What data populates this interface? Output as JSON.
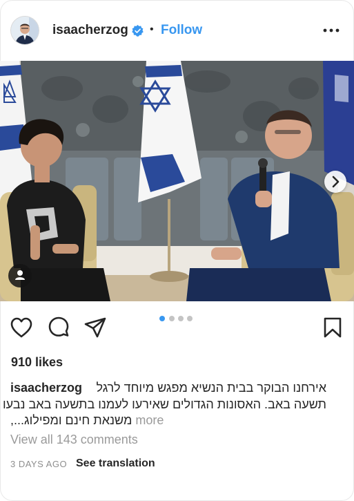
{
  "header": {
    "username": "isaacherzog",
    "separator": "•",
    "follow_label": "Follow"
  },
  "post": {
    "carousel_current_index": 1,
    "carousel_total": 4,
    "likes": "910 likes",
    "caption": {
      "username": "isaacherzog",
      "line1": "אירחנו הבוקר בבית הנשיא מפגש מיוחד לרגל",
      "line2": "תשעה באב. האסונות הגדולים שאירעו לעמנו בתשעה באב נבעו גם",
      "line3": "משנאת חינם ומפילוג...,",
      "more_label": "more"
    },
    "view_comments": "View all 143 comments",
    "time": "3 DAYS AGO",
    "translate_label": "See translation"
  },
  "colors": {
    "accent": "#3897f0",
    "text": "#262626",
    "muted": "#9a9a9a",
    "dot_active": "#3897f0",
    "dot_inactive": "#c4c4c4"
  },
  "icons": [
    "verified-badge-icon",
    "more-options-icon",
    "carousel-next-icon",
    "user-tag-icon",
    "heart-icon",
    "comment-icon",
    "share-icon",
    "bookmark-icon"
  ]
}
